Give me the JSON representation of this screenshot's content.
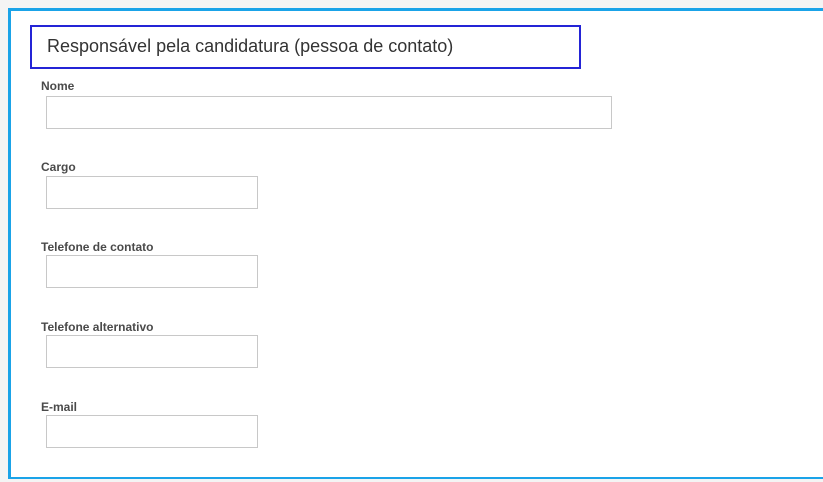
{
  "section": {
    "title": "Responsável pela candidatura (pessoa de contato)"
  },
  "fields": [
    {
      "label": "Nome",
      "value": ""
    },
    {
      "label": "Cargo",
      "value": ""
    },
    {
      "label": "Telefone de contato",
      "value": ""
    },
    {
      "label": "Telefone alternativo",
      "value": ""
    },
    {
      "label": "E-mail",
      "value": ""
    }
  ],
  "colors": {
    "frame_border": "#1aa3e8",
    "title_highlight_border": "#2424d6",
    "input_border": "#c8c8c8",
    "label_text": "#4a4a4a"
  }
}
